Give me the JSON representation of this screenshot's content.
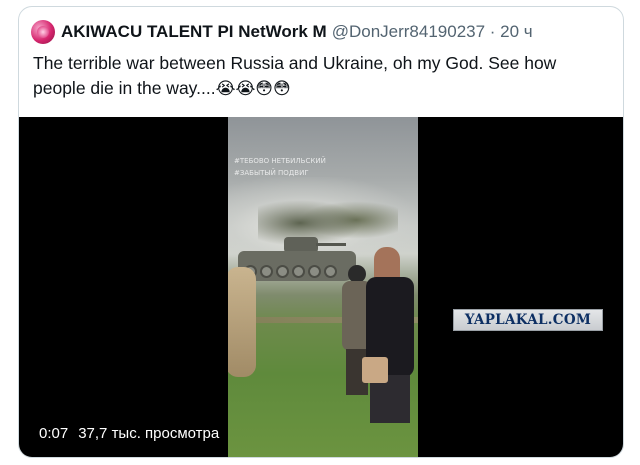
{
  "tweet": {
    "author_name": "AKIWACU TALENT PI NetWork M",
    "handle_time": "@DonJerr84190237 · 20 ч",
    "text": "The terrible war between Russia and Ukraine, oh my God. See how people die in the way....",
    "emoji_line": "😭😭😳😳"
  },
  "video": {
    "time": "0:07",
    "views": "37,7 тыс. просмотра",
    "watermark_line1": "#ТЕБОВО НЕТБИЛЬСКИЙ",
    "watermark_line2": "#ЗАБЫТЫЙ ПОДВИГ"
  },
  "site_badge": "YAPLAKAL.COM",
  "icons": {
    "avatar": "avatar-logo-icon"
  }
}
